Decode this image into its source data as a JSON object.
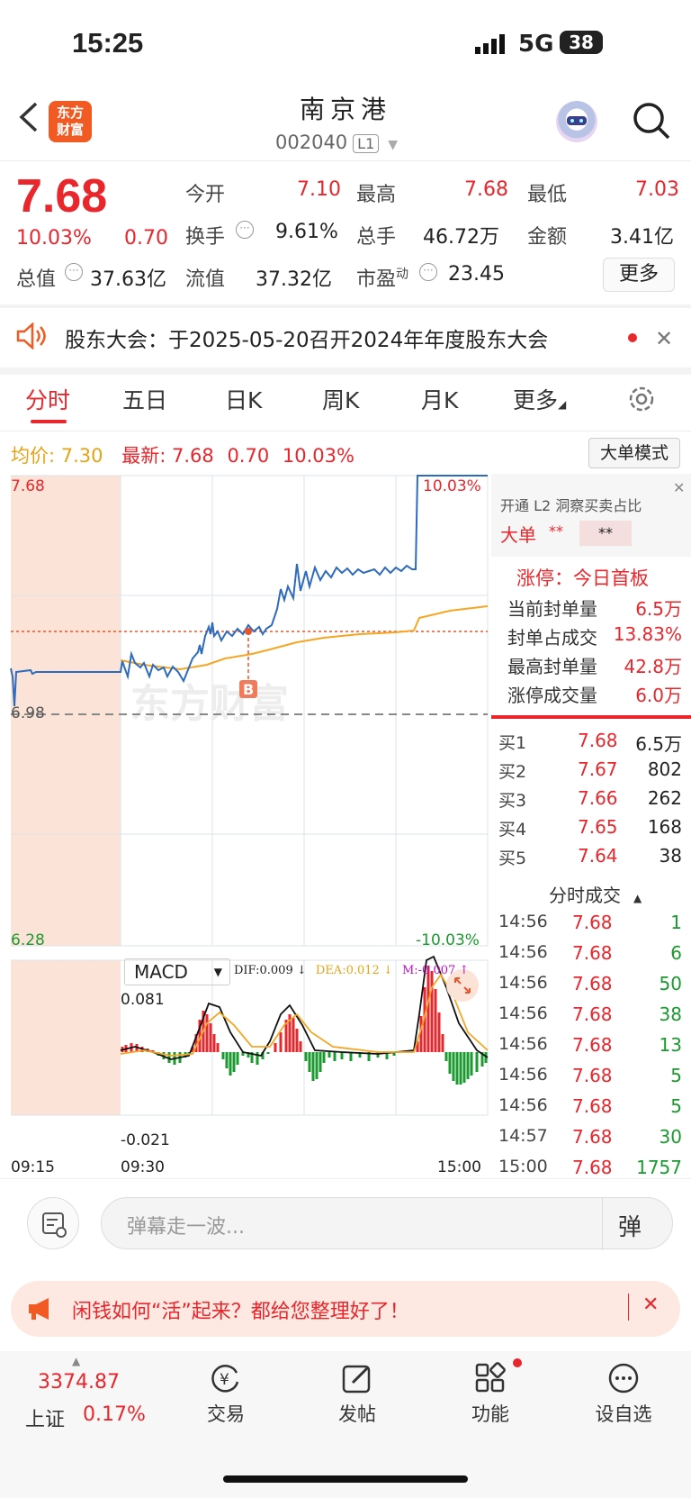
{
  "status": {
    "time": "15:25",
    "network": "5G",
    "battery": "38"
  },
  "header": {
    "title": "南京港",
    "code": "002040",
    "level": "L1",
    "logo_line1": "东方",
    "logo_line2": "财富"
  },
  "quote": {
    "price": "7.68",
    "pct": "10.03%",
    "chg": "0.70",
    "open_label": "今开",
    "open": "7.10",
    "high_label": "最高",
    "high": "7.68",
    "low_label": "最低",
    "low": "7.03",
    "turnover_label": "换手",
    "turnover": "9.61%",
    "vol_label": "总手",
    "vol": "46.72万",
    "amt_label": "金额",
    "amt": "3.41亿",
    "mcap_label": "总值",
    "mcap": "37.63亿",
    "float_label": "流值",
    "float": "37.32亿",
    "pe_label": "市盈",
    "pe_sup": "动",
    "pe": "23.45",
    "more": "更多"
  },
  "notice": {
    "text": "股东大会：于2025-05-20召开2024年年度股东大会"
  },
  "tabs": [
    "分时",
    "五日",
    "日K",
    "周K",
    "月K",
    "更多"
  ],
  "info": {
    "avg_label": "均价:",
    "avg": "7.30",
    "latest_label": "最新:",
    "latest": "7.68",
    "chg": "0.70",
    "pct": "10.03%",
    "mode_btn": "大单模式"
  },
  "chart": {
    "top_price": "7.68",
    "mid_price": "6.98",
    "bottom_price": "6.28",
    "top_pct": "10.03%",
    "bottom_pct": "-10.03%",
    "marker": "B",
    "watermark": "东方财富",
    "times": [
      "09:15",
      "09:30",
      "15:00"
    ]
  },
  "macd": {
    "label": "MACD",
    "dif": "DIF:0.009 ↓",
    "dea": "DEA:0.012 ↓",
    "m": "M:-0.007 ↑",
    "top": "0.081",
    "bottom": "-0.021"
  },
  "side": {
    "l2": "开通 L2 洞察买卖占比",
    "bigorder": "大单",
    "stars1": "**",
    "stars2": "**",
    "limit_title": "涨停：今日首板",
    "limit_rows": [
      {
        "k": "当前封单量",
        "v": "6.5万"
      },
      {
        "k": "封单占成交",
        "v": "13.83%"
      },
      {
        "k": "最高封单量",
        "v": "42.8万"
      },
      {
        "k": "涨停成交量",
        "v": "6.0万"
      }
    ],
    "bids": [
      {
        "k": "买1",
        "p": "7.68",
        "v": "6.5万"
      },
      {
        "k": "买2",
        "p": "7.67",
        "v": "802"
      },
      {
        "k": "买3",
        "p": "7.66",
        "v": "262"
      },
      {
        "k": "买4",
        "p": "7.65",
        "v": "168"
      },
      {
        "k": "买5",
        "p": "7.64",
        "v": "38"
      }
    ],
    "trades_title": "分时成交",
    "trades": [
      {
        "t": "14:56",
        "p": "7.68",
        "v": "1"
      },
      {
        "t": "14:56",
        "p": "7.68",
        "v": "6"
      },
      {
        "t": "14:56",
        "p": "7.68",
        "v": "50"
      },
      {
        "t": "14:56",
        "p": "7.68",
        "v": "38"
      },
      {
        "t": "14:56",
        "p": "7.68",
        "v": "13"
      },
      {
        "t": "14:56",
        "p": "7.68",
        "v": "5"
      },
      {
        "t": "14:56",
        "p": "7.68",
        "v": "5"
      },
      {
        "t": "14:57",
        "p": "7.68",
        "v": "30"
      },
      {
        "t": "15:00",
        "p": "7.68",
        "v": "1757"
      }
    ]
  },
  "comment": {
    "placeholder": "弹幕走一波...",
    "danmu": "弹"
  },
  "ad": {
    "text": "闲钱如何“活”起来？都给您整理好了！"
  },
  "nav": {
    "index_value": "3374.87",
    "index_name": "上证",
    "index_pct": "0.17%",
    "items": [
      "交易",
      "发帖",
      "功能",
      "设自选"
    ]
  },
  "colors": {
    "up": "#e8262c",
    "down": "#1a9a2e",
    "avg": "#f5a623",
    "price_line": "#2f6bbd"
  }
}
